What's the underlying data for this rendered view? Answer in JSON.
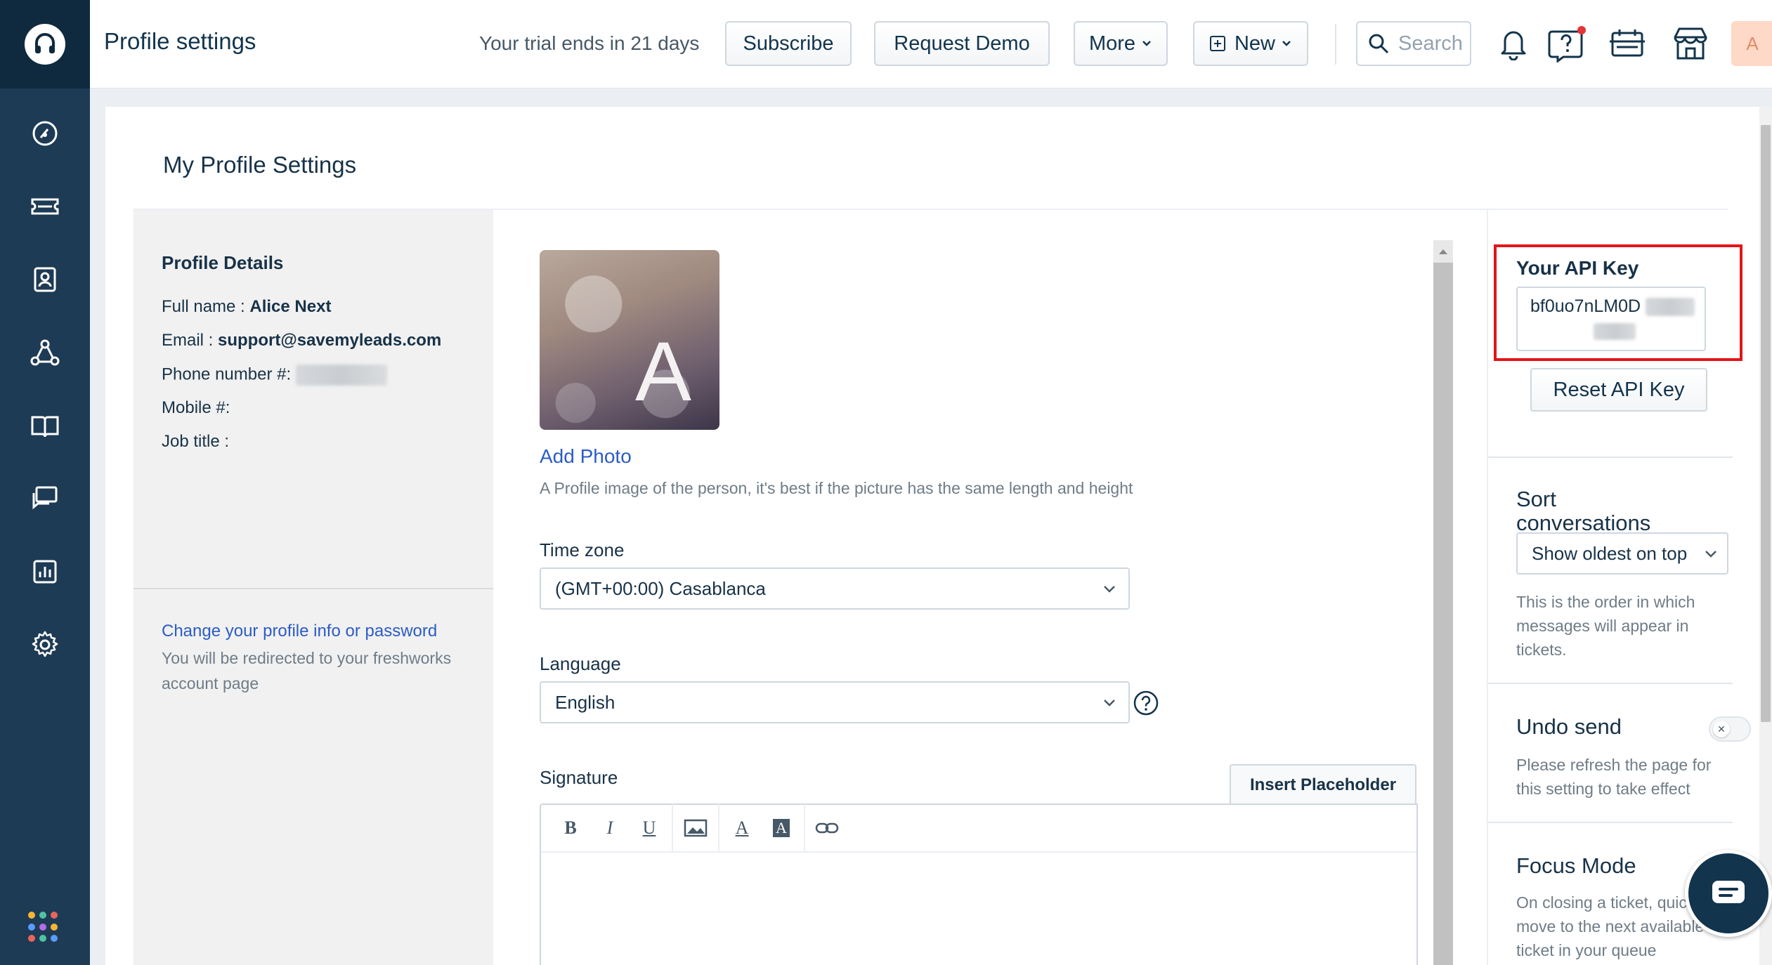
{
  "header": {
    "title": "Profile settings",
    "trial_text": "Your trial ends in 21 days",
    "subscribe_label": "Subscribe",
    "request_demo_label": "Request Demo",
    "more_label": "More",
    "new_label": "New",
    "search_placeholder": "Search",
    "avatar_initial": "A"
  },
  "page": {
    "title": "My Profile Settings"
  },
  "profile_details": {
    "title": "Profile Details",
    "full_name_label": "Full name : ",
    "full_name_value": "Alice Next",
    "email_label": "Email : ",
    "email_value": "support@savemyleads.com",
    "phone_label": "Phone number #:",
    "mobile_label": "Mobile #:",
    "job_title_label": "Job title :",
    "change_link": "Change your profile info or password",
    "redirect_note": "You will be redirected to your freshworks account page"
  },
  "photo": {
    "initial": "A",
    "add_label": "Add Photo",
    "hint": "A Profile image of the person, it's best if the picture has the same length and height"
  },
  "form": {
    "timezone_label": "Time zone",
    "timezone_value": "(GMT+00:00) Casablanca",
    "language_label": "Language",
    "language_value": "English",
    "signature_label": "Signature",
    "insert_placeholder_label": "Insert Placeholder",
    "toolbar": {
      "bold": "B",
      "italic": "I",
      "underline": "U",
      "font_color": "A",
      "bg_color": "A"
    }
  },
  "api": {
    "title": "Your API Key",
    "key_visible": "bf0uo7nLM0D",
    "reset_label": "Reset API Key"
  },
  "sort": {
    "title": "Sort conversations",
    "value": "Show oldest on top",
    "note": "This is the order in which messages will appear in tickets."
  },
  "undo": {
    "title": "Undo send",
    "note": "Please refresh the page for this setting to take effect"
  },
  "focus": {
    "title": "Focus Mode",
    "note": "On closing a ticket, quickly move to the next available ticket in your queue"
  },
  "colors": {
    "sidebar": "#1e3b55",
    "logo_bg": "#0f2a3f",
    "link": "#2c5cc5",
    "highlight": "#e3141a",
    "notify_dot": "#e43538"
  }
}
